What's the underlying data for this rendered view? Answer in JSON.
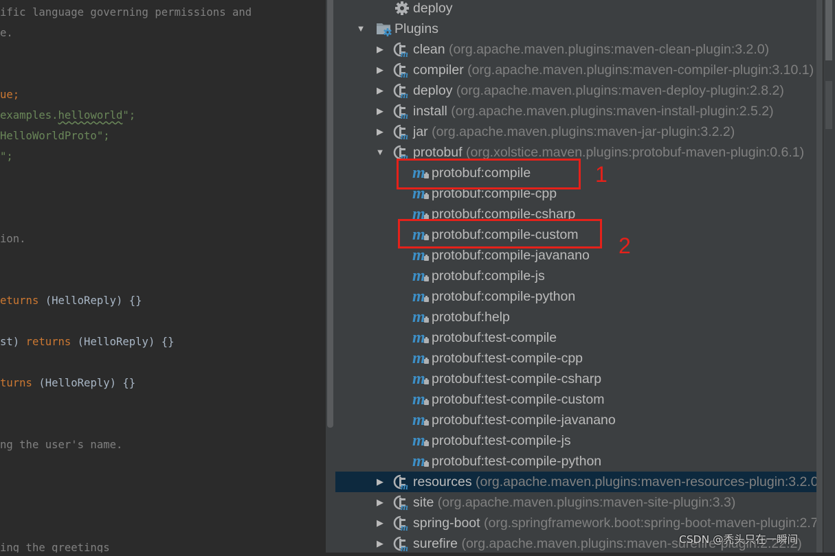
{
  "editor": {
    "lines": [
      [
        {
          "t": "ific language governing permissions and",
          "c": "comment"
        }
      ],
      [
        {
          "t": "e.",
          "c": "comment"
        }
      ],
      [],
      [],
      [
        {
          "t": "ue;",
          "c": "keyword"
        }
      ],
      [
        {
          "t": "examples.",
          "c": "string"
        },
        {
          "t": "helloworld",
          "c": "string",
          "squiggle": true
        },
        {
          "t": "\";",
          "c": "string"
        }
      ],
      [
        {
          "t": "HelloWorldProto\";",
          "c": "string"
        }
      ],
      [
        {
          "t": "\";",
          "c": "string"
        }
      ],
      [],
      [],
      [],
      [
        {
          "t": "ion.",
          "c": "comment"
        }
      ],
      [],
      [],
      [
        {
          "t": "eturns",
          "c": "keyword"
        },
        {
          "t": " (HelloReply) {}",
          "c": "plain"
        }
      ],
      [],
      [
        {
          "t": "st) ",
          "c": "plain"
        },
        {
          "t": "returns",
          "c": "keyword"
        },
        {
          "t": " (HelloReply) {}",
          "c": "plain"
        }
      ],
      [],
      [
        {
          "t": "turns",
          "c": "keyword"
        },
        {
          "t": " (HelloReply) {}",
          "c": "plain"
        }
      ],
      [],
      [],
      [
        {
          "t": "ng the user's name.",
          "c": "comment"
        }
      ],
      [],
      [],
      [],
      [],
      [
        {
          "t": "ing the greetings",
          "c": "comment"
        }
      ]
    ]
  },
  "maven_tree": {
    "rows": [
      {
        "label": "deploy",
        "coord": "",
        "icon": "gear-icon",
        "level": "phase",
        "expander": "none"
      },
      {
        "label": "Plugins",
        "coord": "",
        "icon": "plugins-folder-icon",
        "level": "group",
        "expander": "expanded"
      },
      {
        "label": "clean",
        "coord": "(org.apache.maven.plugins:maven-clean-plugin:3.2.0)",
        "icon": "maven-plugin-icon",
        "level": "plugin",
        "expander": "collapsed"
      },
      {
        "label": "compiler",
        "coord": "(org.apache.maven.plugins:maven-compiler-plugin:3.10.1)",
        "icon": "maven-plugin-icon",
        "level": "plugin",
        "expander": "collapsed"
      },
      {
        "label": "deploy",
        "coord": "(org.apache.maven.plugins:maven-deploy-plugin:2.8.2)",
        "icon": "maven-plugin-icon",
        "level": "plugin",
        "expander": "collapsed"
      },
      {
        "label": "install",
        "coord": "(org.apache.maven.plugins:maven-install-plugin:2.5.2)",
        "icon": "maven-plugin-icon",
        "level": "plugin",
        "expander": "collapsed"
      },
      {
        "label": "jar",
        "coord": "(org.apache.maven.plugins:maven-jar-plugin:3.2.2)",
        "icon": "maven-plugin-icon",
        "level": "plugin",
        "expander": "collapsed"
      },
      {
        "label": "protobuf",
        "coord": "(org.xolstice.maven.plugins:protobuf-maven-plugin:0.6.1)",
        "icon": "maven-plugin-icon",
        "level": "plugin",
        "expander": "expanded"
      },
      {
        "label": "protobuf:compile",
        "coord": "",
        "icon": "maven-goal-icon",
        "level": "goal",
        "expander": "none",
        "highlight": "1"
      },
      {
        "label": "protobuf:compile-cpp",
        "coord": "",
        "icon": "maven-goal-icon",
        "level": "goal",
        "expander": "none"
      },
      {
        "label": "protobuf:compile-csharp",
        "coord": "",
        "icon": "maven-goal-icon",
        "level": "goal",
        "expander": "none"
      },
      {
        "label": "protobuf:compile-custom",
        "coord": "",
        "icon": "maven-goal-icon",
        "level": "goal",
        "expander": "none",
        "highlight": "2"
      },
      {
        "label": "protobuf:compile-javanano",
        "coord": "",
        "icon": "maven-goal-icon",
        "level": "goal",
        "expander": "none"
      },
      {
        "label": "protobuf:compile-js",
        "coord": "",
        "icon": "maven-goal-icon",
        "level": "goal",
        "expander": "none"
      },
      {
        "label": "protobuf:compile-python",
        "coord": "",
        "icon": "maven-goal-icon",
        "level": "goal",
        "expander": "none"
      },
      {
        "label": "protobuf:help",
        "coord": "",
        "icon": "maven-goal-icon",
        "level": "goal",
        "expander": "none"
      },
      {
        "label": "protobuf:test-compile",
        "coord": "",
        "icon": "maven-goal-icon",
        "level": "goal",
        "expander": "none"
      },
      {
        "label": "protobuf:test-compile-cpp",
        "coord": "",
        "icon": "maven-goal-icon",
        "level": "goal",
        "expander": "none"
      },
      {
        "label": "protobuf:test-compile-csharp",
        "coord": "",
        "icon": "maven-goal-icon",
        "level": "goal",
        "expander": "none"
      },
      {
        "label": "protobuf:test-compile-custom",
        "coord": "",
        "icon": "maven-goal-icon",
        "level": "goal",
        "expander": "none"
      },
      {
        "label": "protobuf:test-compile-javanano",
        "coord": "",
        "icon": "maven-goal-icon",
        "level": "goal",
        "expander": "none"
      },
      {
        "label": "protobuf:test-compile-js",
        "coord": "",
        "icon": "maven-goal-icon",
        "level": "goal",
        "expander": "none"
      },
      {
        "label": "protobuf:test-compile-python",
        "coord": "",
        "icon": "maven-goal-icon",
        "level": "goal",
        "expander": "none"
      },
      {
        "label": "resources",
        "coord": "(org.apache.maven.plugins:maven-resources-plugin:3.2.0)",
        "icon": "maven-plugin-icon",
        "level": "plugin",
        "expander": "collapsed",
        "selected": true
      },
      {
        "label": "site",
        "coord": "(org.apache.maven.plugins:maven-site-plugin:3.3)",
        "icon": "maven-plugin-icon",
        "level": "plugin",
        "expander": "collapsed"
      },
      {
        "label": "spring-boot",
        "coord": "(org.springframework.boot:spring-boot-maven-plugin:2.7",
        "icon": "maven-plugin-icon",
        "level": "plugin",
        "expander": "collapsed"
      },
      {
        "label": "surefire",
        "coord": "(org.apache.maven.plugins:maven-surefire-plugin:2.22.2)",
        "icon": "maven-plugin-icon",
        "level": "plugin",
        "expander": "collapsed"
      }
    ]
  },
  "annotations": [
    {
      "number": "1"
    },
    {
      "number": "2"
    }
  ],
  "watermark": "CSDN @秃头只在一瞬间",
  "colors": {
    "editor_bg": "#2b2b2b",
    "panel_bg": "#3c3f41",
    "selection": "#0d293e",
    "annotation_red": "#e5211a",
    "maven_icon_blue": "#3d8fc6",
    "keyword": "#cc7832",
    "string": "#6a8759",
    "comment": "#808080"
  }
}
